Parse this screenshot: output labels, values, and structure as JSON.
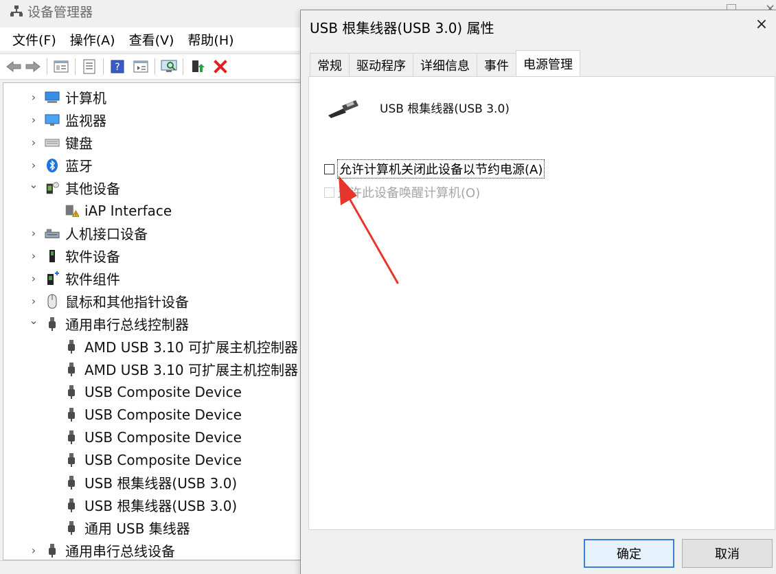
{
  "device_manager": {
    "title": "设备管理器",
    "menu": [
      "文件(F)",
      "操作(A)",
      "查看(V)",
      "帮助(H)"
    ],
    "tree": [
      {
        "label": "计算机",
        "level": 0,
        "expanded": false,
        "icon": "computer-icon"
      },
      {
        "label": "监视器",
        "level": 0,
        "expanded": false,
        "icon": "monitor-icon"
      },
      {
        "label": "键盘",
        "level": 0,
        "expanded": false,
        "icon": "keyboard-icon"
      },
      {
        "label": "蓝牙",
        "level": 0,
        "expanded": false,
        "icon": "bluetooth-icon"
      },
      {
        "label": "其他设备",
        "level": 0,
        "expanded": true,
        "icon": "other-devices-icon"
      },
      {
        "label": "iAP Interface",
        "level": 1,
        "icon": "warning-device-icon"
      },
      {
        "label": "人机接口设备",
        "level": 0,
        "expanded": false,
        "icon": "hid-icon"
      },
      {
        "label": "软件设备",
        "level": 0,
        "expanded": false,
        "icon": "software-device-icon"
      },
      {
        "label": "软件组件",
        "level": 0,
        "expanded": false,
        "icon": "software-component-icon"
      },
      {
        "label": "鼠标和其他指针设备",
        "level": 0,
        "expanded": false,
        "icon": "mouse-icon"
      },
      {
        "label": "通用串行总线控制器",
        "level": 0,
        "expanded": true,
        "icon": "usb-plug-icon"
      },
      {
        "label": "AMD USB 3.10 可扩展主机控制器",
        "level": 1,
        "icon": "usb-plug-icon"
      },
      {
        "label": "AMD USB 3.10 可扩展主机控制器",
        "level": 1,
        "icon": "usb-plug-icon"
      },
      {
        "label": "USB Composite Device",
        "level": 1,
        "icon": "usb-plug-icon"
      },
      {
        "label": "USB Composite Device",
        "level": 1,
        "icon": "usb-plug-icon"
      },
      {
        "label": "USB Composite Device",
        "level": 1,
        "icon": "usb-plug-icon"
      },
      {
        "label": "USB Composite Device",
        "level": 1,
        "icon": "usb-plug-icon"
      },
      {
        "label": "USB 根集线器(USB 3.0)",
        "level": 1,
        "icon": "usb-plug-icon"
      },
      {
        "label": "USB 根集线器(USB 3.0)",
        "level": 1,
        "icon": "usb-plug-icon"
      },
      {
        "label": "通用 USB 集线器",
        "level": 1,
        "icon": "usb-plug-icon"
      },
      {
        "label": "通用串行总线设备",
        "level": 0,
        "expanded": false,
        "icon": "usb-plug-icon"
      }
    ],
    "chevron_collapsed": "›",
    "chevron_expanded": "⌄"
  },
  "dialog": {
    "title": "USB 根集线器(USB 3.0) 属性",
    "close_glyph": "×",
    "tabs": [
      "常规",
      "驱动程序",
      "详细信息",
      "事件",
      "电源管理"
    ],
    "active_tab_index": 4,
    "device_name": "USB 根集线器(USB 3.0)",
    "option_allow_power_off": {
      "label": "允许计算机关闭此设备以节约电源(A)",
      "checked": false,
      "enabled": true
    },
    "option_allow_wake": {
      "label": "允许此设备唤醒计算机(O)",
      "checked": false,
      "enabled": false
    },
    "ok_label": "确定",
    "cancel_label": "取消"
  },
  "colors": {
    "annotation_arrow": "#e8352b",
    "ok_focus_border": "#3c7fd1",
    "error_x": "#e02020"
  }
}
